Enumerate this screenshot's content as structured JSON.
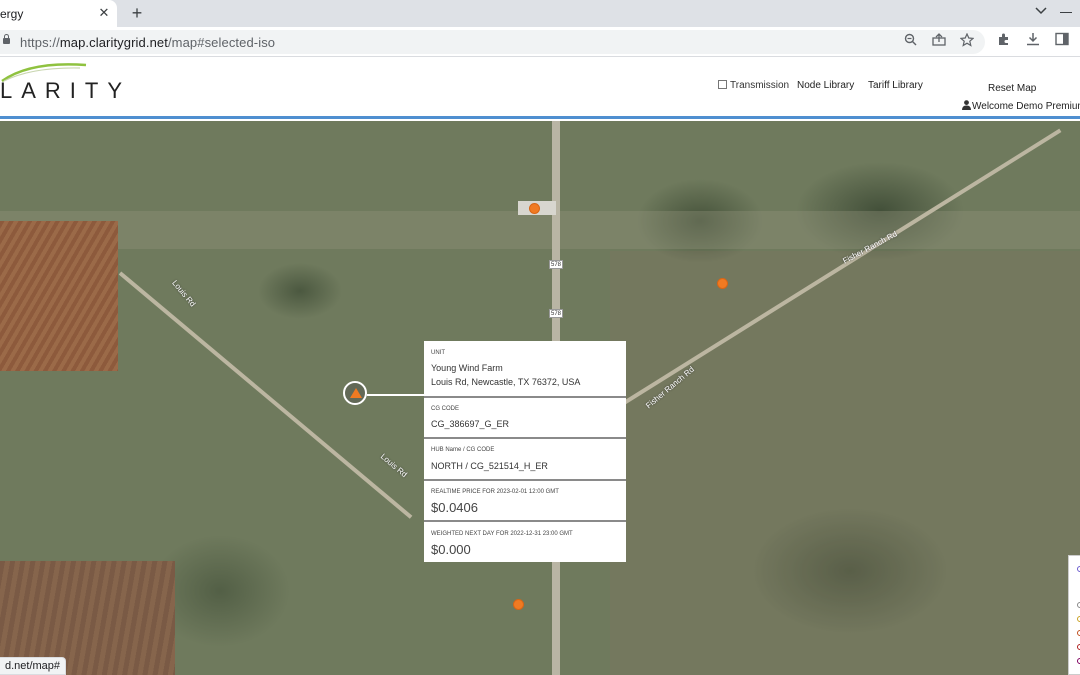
{
  "browser": {
    "tab_title": "ergy",
    "tab_close": "✕",
    "new_tab": "+",
    "url_prefix": "https://",
    "url_host": "map.claritygrid.net",
    "url_path": "/map#selected-iso",
    "status_url": "d.net/map#"
  },
  "header": {
    "logo_text": "LARITY",
    "transmission_label": "Transmission",
    "transmission_checked": false,
    "nav": [
      "Node Library",
      "Tariff Library"
    ],
    "reset_map": "Reset Map",
    "welcome": "Welcome Demo Premium"
  },
  "map": {
    "road_labels": {
      "louis_1": "Louis Rd",
      "louis_2": "Louis Rd",
      "fisher_1": "Fisher Ranch Rd",
      "fisher_2": "Fisher Ranch Rd"
    },
    "route_shields": [
      "578",
      "578"
    ],
    "marker_color": "#f07a22"
  },
  "popup": {
    "unit_label": "UNIT",
    "unit_name": "Young Wind Farm",
    "unit_address": "Louis Rd, Newcastle, TX 76372, USA",
    "cg_code_label": "CG CODE",
    "cg_code": "CG_386697_G_ER",
    "hub_label": "HUB Name / CG CODE",
    "hub_value": "NORTH / CG_521514_H_ER",
    "realtime_label": "REALTIME PRICE FOR 2023-02-01 12:00 GMT",
    "realtime_price": "$0.0406",
    "weighted_label": "WEIGHTED NEXT DAY FOR 2022-12-31 23:00 GMT",
    "weighted_price": "$0.000"
  }
}
